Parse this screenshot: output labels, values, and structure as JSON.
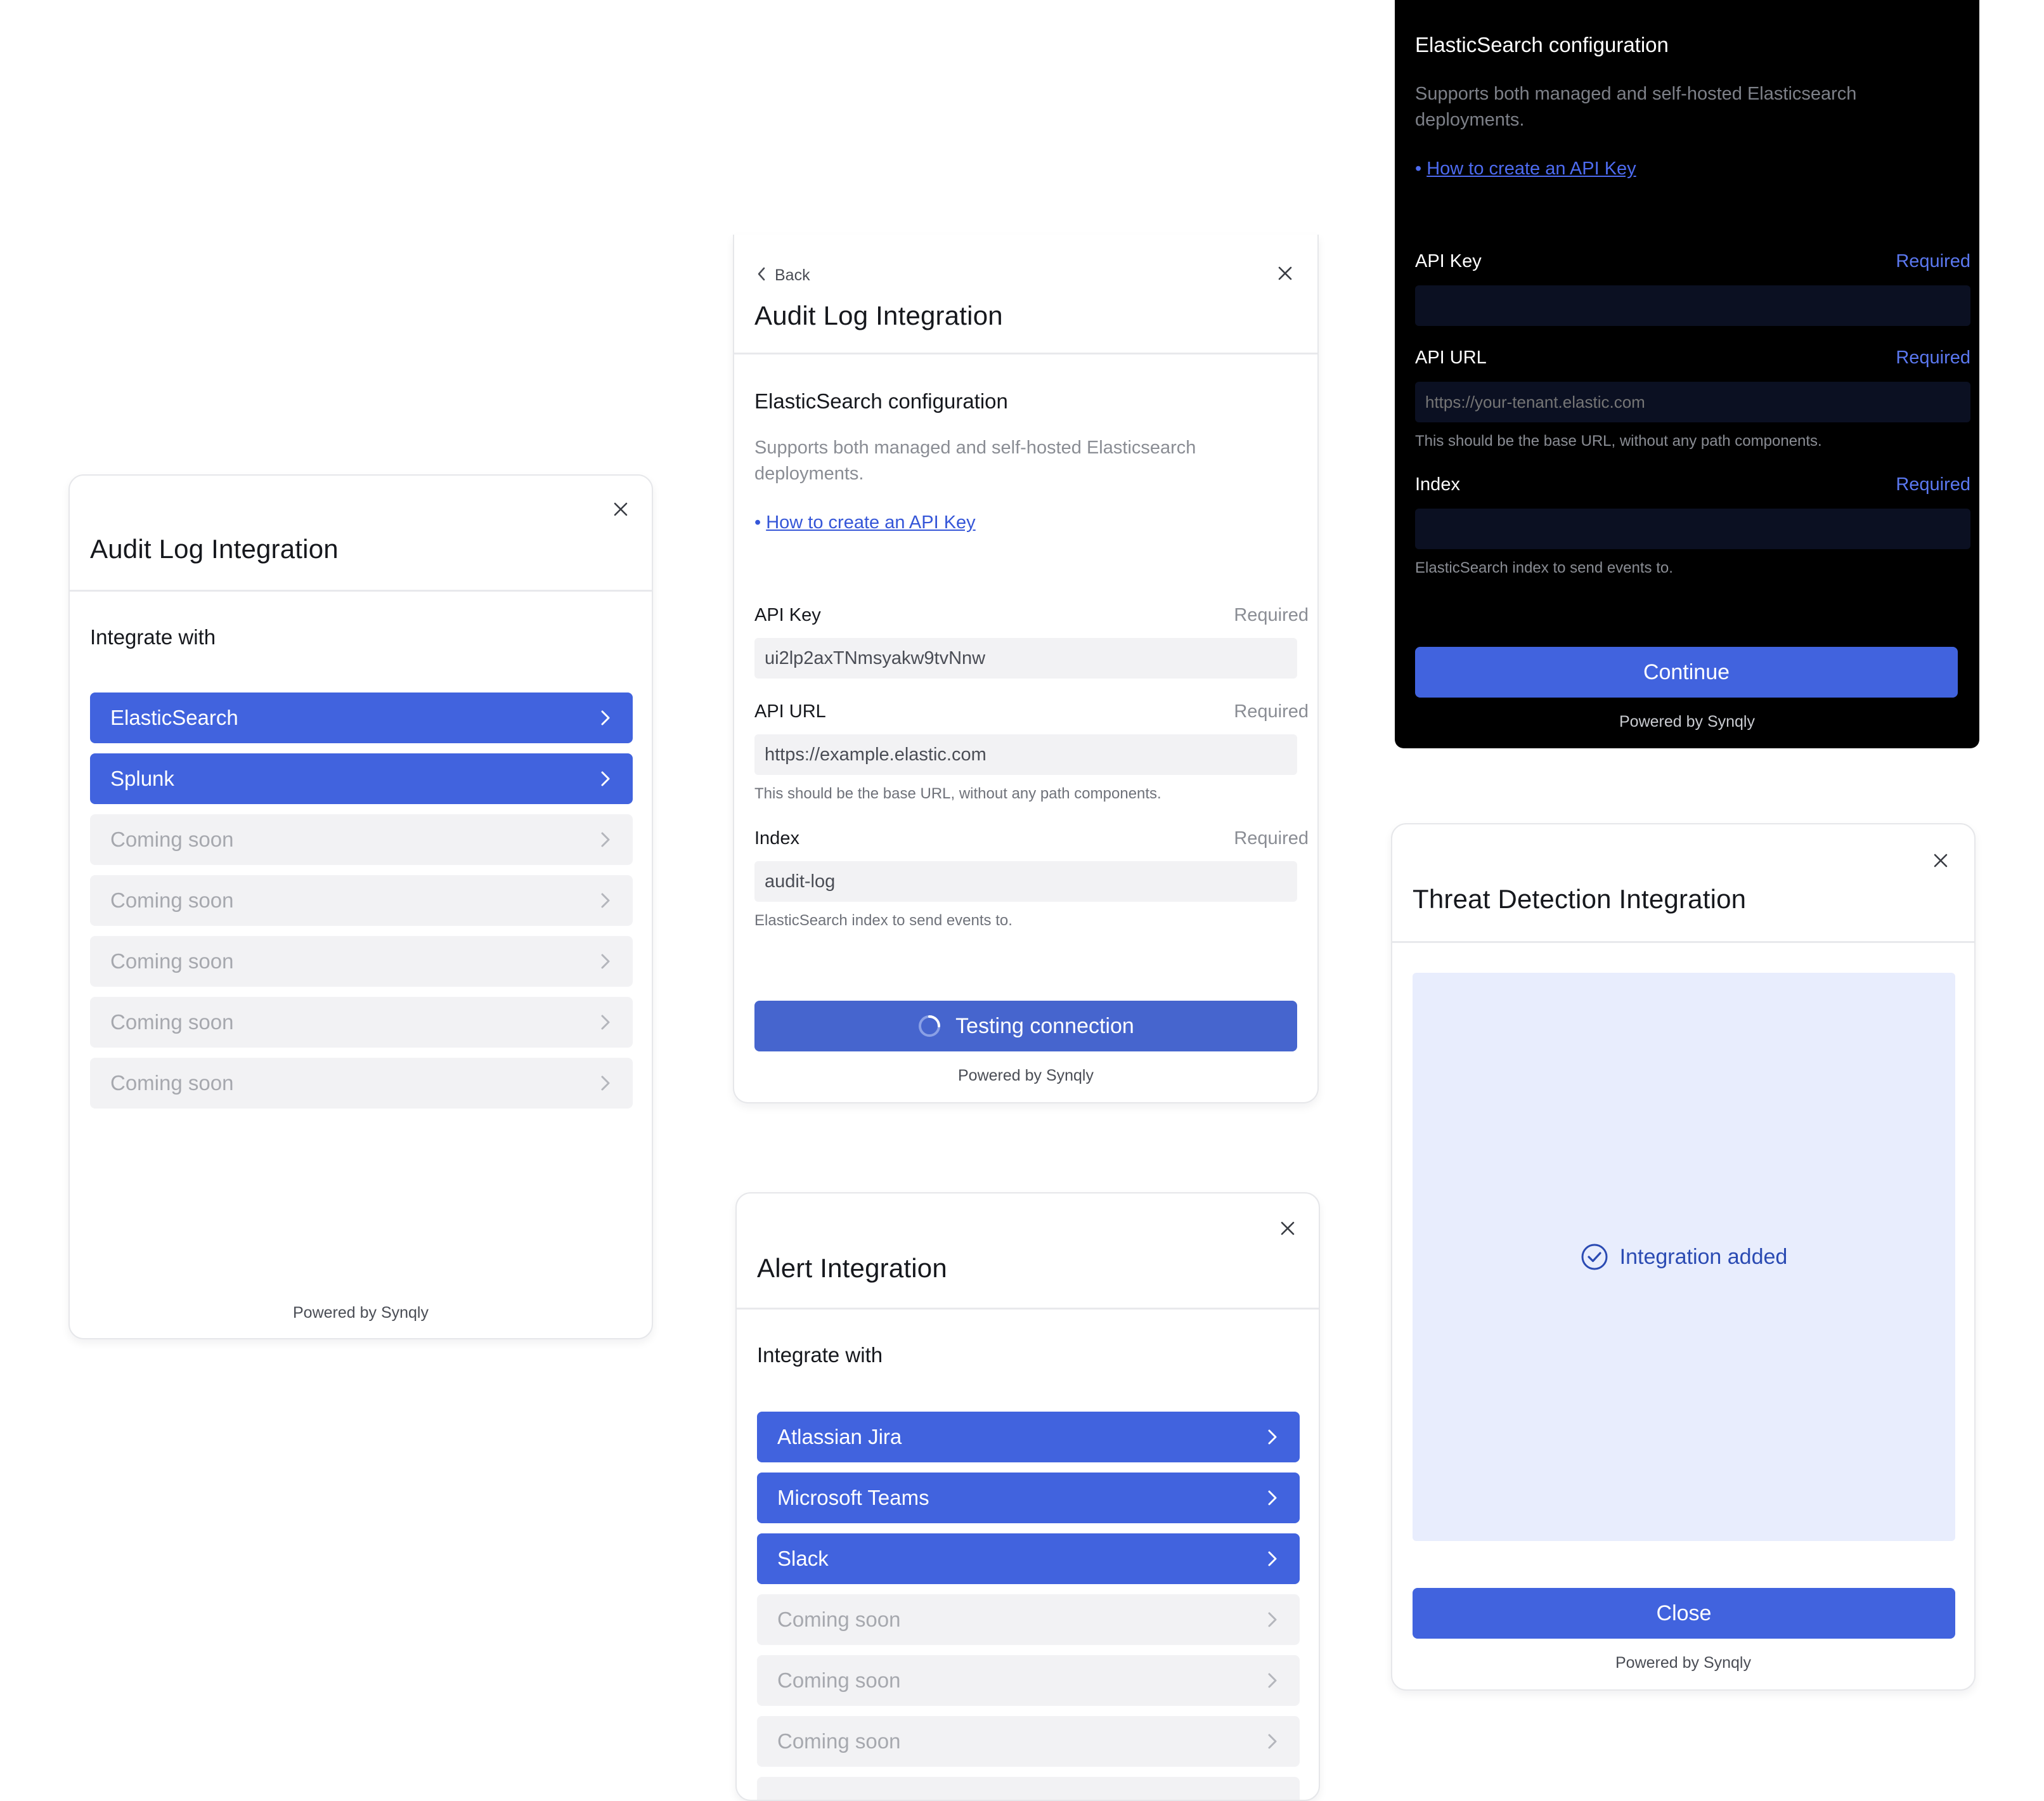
{
  "powered_by": "Powered by Synqly",
  "card1": {
    "title": "Audit Log Integration",
    "section": "Integrate with",
    "items": [
      {
        "label": "ElasticSearch"
      },
      {
        "label": "Splunk"
      },
      {
        "label": "Coming soon"
      },
      {
        "label": "Coming soon"
      },
      {
        "label": "Coming soon"
      },
      {
        "label": "Coming soon"
      },
      {
        "label": "Coming soon"
      }
    ]
  },
  "card2": {
    "back_label": "Back",
    "title": "Audit Log Integration",
    "config_title": "ElasticSearch configuration",
    "description": "Supports both managed and self-hosted Elasticsearch deployments.",
    "bullet": "•",
    "link": "How to create an API Key",
    "fields": {
      "api_key": {
        "label": "API Key",
        "required": "Required",
        "value": "ui2lp2axTNmsyakw9tvNnw"
      },
      "api_url": {
        "label": "API URL",
        "required": "Required",
        "value": "https://example.elastic.com",
        "hint": "This should be the base URL, without any path components."
      },
      "index": {
        "label": "Index",
        "required": "Required",
        "value": "audit-log",
        "hint": "ElasticSearch index to send events to."
      }
    },
    "button": "Testing connection"
  },
  "card3": {
    "config_title": "ElasticSearch configuration",
    "description": "Supports both managed and self-hosted Elasticsearch deployments.",
    "bullet": "•",
    "link": "How to create an API Key",
    "fields": {
      "api_key": {
        "label": "API Key",
        "required": "Required",
        "value": ""
      },
      "api_url": {
        "label": "API URL",
        "required": "Required",
        "placeholder": "https://your-tenant.elastic.com",
        "hint": "This should be the base URL, without any path components."
      },
      "index": {
        "label": "Index",
        "required": "Required",
        "value": "",
        "hint": "ElasticSearch index to send events to."
      }
    },
    "button": "Continue"
  },
  "card4": {
    "title": "Alert Integration",
    "section": "Integrate with",
    "items": [
      {
        "label": "Atlassian Jira"
      },
      {
        "label": "Microsoft Teams"
      },
      {
        "label": "Slack"
      },
      {
        "label": "Coming soon"
      },
      {
        "label": "Coming soon"
      },
      {
        "label": "Coming soon"
      }
    ]
  },
  "card5": {
    "title": "Threat Detection Integration",
    "status": "Integration added",
    "button": "Close"
  },
  "colors": {
    "accent": "#4163de",
    "link": "#3556d8",
    "success_panel": "#e8edfd",
    "success_text": "#2b4bb3"
  }
}
